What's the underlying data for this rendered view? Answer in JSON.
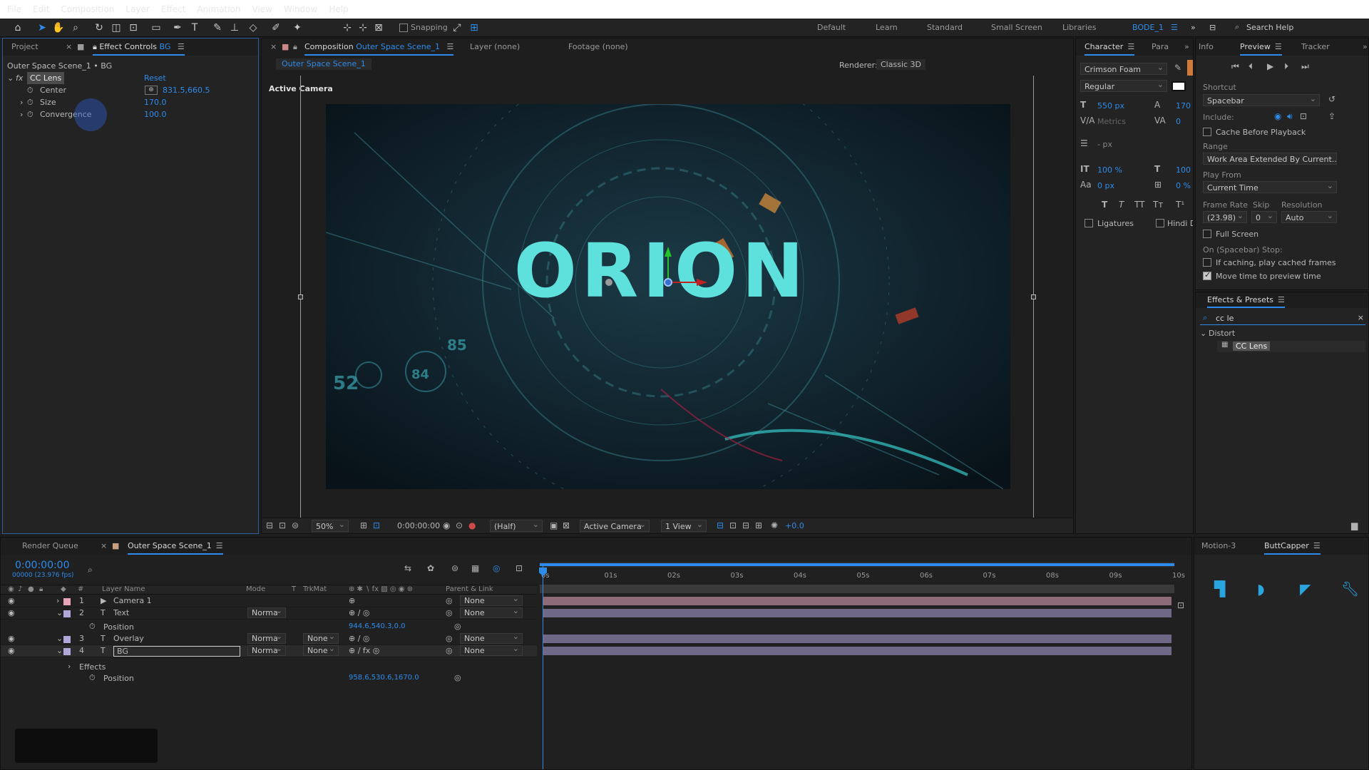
{
  "menu": [
    "File",
    "Edit",
    "Composition",
    "Layer",
    "Effect",
    "Animation",
    "View",
    "Window",
    "Help"
  ],
  "toolbar": {
    "snapping_label": "Snapping",
    "workspaces": [
      "Default",
      "Learn",
      "Standard",
      "Small Screen",
      "Libraries",
      "BODE_1"
    ],
    "search_placeholder": "Search Help"
  },
  "left_panel": {
    "tab_project": "Project",
    "tab_effect_controls": "Effect Controls",
    "tab_effect_controls_layer": "BG",
    "breadcrumb": "Outer Space Scene_1 • BG",
    "effect": {
      "fx": "fx",
      "name": "CC Lens",
      "reset": "Reset",
      "params": [
        {
          "label": "Center",
          "value": "831.5,660.5"
        },
        {
          "label": "Size",
          "value": "170.0"
        },
        {
          "label": "Convergence",
          "value": "100.0"
        }
      ]
    }
  },
  "comp_panel": {
    "tab_composition_label": "Composition",
    "tab_composition_name": "Outer Space Scene_1",
    "tab_layer": "Layer (none)",
    "tab_footage": "Footage (none)",
    "subtab": "Outer Space Scene_1",
    "renderer_label": "Renderer:",
    "renderer_value": "Classic 3D",
    "camera_label": "Active Camera",
    "title_text": "ORION",
    "footer": {
      "zoom": "50%",
      "timecode": "0:00:00:00",
      "resolution": "(Half)",
      "camera": "Active Camera",
      "views": "1 View",
      "exposure": "+0.0"
    }
  },
  "character_panel": {
    "tab_character": "Character",
    "tab_para": "Para",
    "font": "Crimson Foam",
    "style": "Regular",
    "size": "550 px",
    "leading": "170",
    "kerning": "Metrics",
    "tracking": "0",
    "stroke": "- px",
    "vscale": "100 %",
    "hscale": "100",
    "baseline": "0 px",
    "tsume": "0 %",
    "ligatures": "Ligatures",
    "hindi": "Hindi Di"
  },
  "preview_panel": {
    "tab_info": "Info",
    "tab_preview": "Preview",
    "tab_tracker": "Tracker",
    "shortcut_label": "Shortcut",
    "shortcut": "Spacebar",
    "include_label": "Include:",
    "cache": "Cache Before Playback",
    "range_label": "Range",
    "range": "Work Area Extended By Current...",
    "play_from_label": "Play From",
    "play_from": "Current Time",
    "frame_rate_label": "Frame Rate",
    "skip_label": "Skip",
    "resolution_label": "Resolution",
    "frame_rate": "(23.98)",
    "skip": "0",
    "resolution": "Auto",
    "full_screen": "Full Screen",
    "stop_label": "On (Spacebar) Stop:",
    "if_caching": "If caching, play cached frames",
    "move_time": "Move time to preview time"
  },
  "effects_presets": {
    "title": "Effects & Presets",
    "search": "cc le",
    "category": "Distort",
    "item": "CC Lens"
  },
  "timeline": {
    "tab_render_queue": "Render Queue",
    "tab_comp": "Outer Space Scene_1",
    "timecode": "0:00:00:00",
    "frame_info": "00000 (23.976 fps)",
    "col_layer_name": "Layer Name",
    "col_mode": "Mode",
    "col_t": "T",
    "col_trkmat": "TrkMat",
    "col_parent": "Parent & Link",
    "col_num": "#",
    "ticks": [
      "0s",
      "01s",
      "02s",
      "03s",
      "04s",
      "05s",
      "06s",
      "07s",
      "08s",
      "09s",
      "10s"
    ],
    "layers": [
      {
        "num": "1",
        "name": "Camera 1",
        "mode": "",
        "trkmat": "",
        "parent": "None",
        "color": "#e8a5b5"
      },
      {
        "num": "2",
        "name": "Text",
        "mode": "Norma",
        "trkmat": "",
        "parent": "None",
        "color": "#b3a6d9"
      },
      {
        "num": "3",
        "name": "Overlay",
        "mode": "Norma",
        "trkmat": "None",
        "parent": "None",
        "color": "#b3a6d9"
      },
      {
        "num": "4",
        "name": "BG",
        "mode": "Norma",
        "trkmat": "None",
        "parent": "None",
        "color": "#b3a6d9"
      }
    ],
    "text_position_label": "Position",
    "text_position_value": "944.6,540.3,0.0",
    "effects_label": "Effects",
    "bg_position_label": "Position",
    "bg_position_value": "958.6,530.6,1670.0"
  },
  "right_bottom": {
    "tab_motion": "Motion-3",
    "tab_buttcapper": "ButtCapper"
  },
  "colors": {
    "accent": "#2d8ceb",
    "title_cyan": "#5ee0dc",
    "panel_bg": "#232323"
  }
}
